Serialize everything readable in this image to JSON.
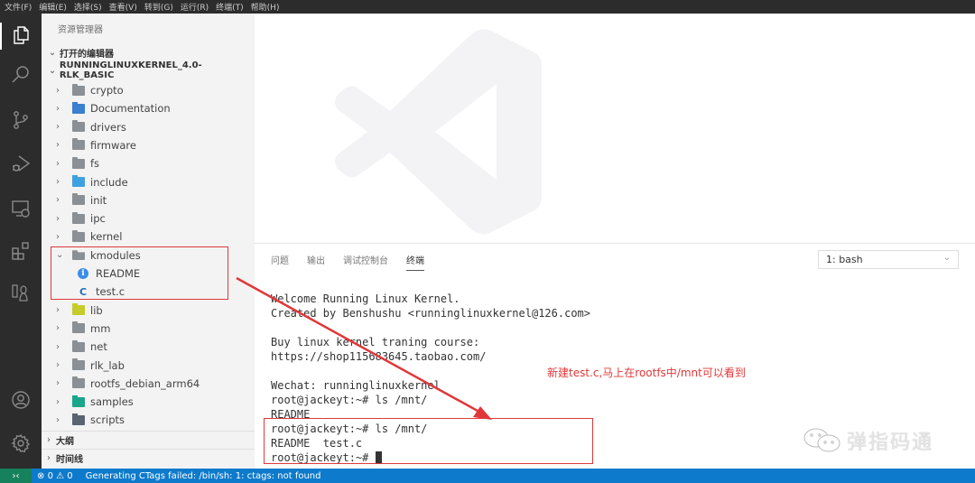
{
  "menubar": {
    "items": [
      "文件(F)",
      "编辑(E)",
      "选择(S)",
      "查看(V)",
      "转到(G)",
      "运行(R)",
      "终端(T)",
      "帮助(H)"
    ]
  },
  "activitybar": {
    "items": [
      "explorer-icon",
      "search-icon",
      "source-control-icon",
      "run-debug-icon",
      "remote-explorer-icon",
      "extensions-icon",
      "linux-icon"
    ],
    "bottom": [
      "account-icon",
      "settings-gear-icon"
    ]
  },
  "sidebar": {
    "title": "资源管理器",
    "open_editors": "打开的编辑器",
    "project": "RUNNINGLINUXKERNEL_4.0-RLK_BASIC",
    "tree": [
      {
        "name": "crypto",
        "type": "folder",
        "icon": "folder"
      },
      {
        "name": "Documentation",
        "type": "folder",
        "icon": "folder-doc"
      },
      {
        "name": "drivers",
        "type": "folder",
        "icon": "folder"
      },
      {
        "name": "firmware",
        "type": "folder",
        "icon": "folder"
      },
      {
        "name": "fs",
        "type": "folder",
        "icon": "folder"
      },
      {
        "name": "include",
        "type": "folder",
        "icon": "folder-inc"
      },
      {
        "name": "init",
        "type": "folder",
        "icon": "folder"
      },
      {
        "name": "ipc",
        "type": "folder",
        "icon": "folder"
      },
      {
        "name": "kernel",
        "type": "folder",
        "icon": "folder"
      },
      {
        "name": "kmodules",
        "type": "folder-open",
        "icon": "folder-open"
      },
      {
        "name": "README",
        "type": "file",
        "icon": "info"
      },
      {
        "name": "test.c",
        "type": "file",
        "icon": "c"
      },
      {
        "name": "lib",
        "type": "folder",
        "icon": "folder-lib"
      },
      {
        "name": "mm",
        "type": "folder",
        "icon": "folder"
      },
      {
        "name": "net",
        "type": "folder",
        "icon": "folder"
      },
      {
        "name": "rlk_lab",
        "type": "folder",
        "icon": "folder"
      },
      {
        "name": "rootfs_debian_arm64",
        "type": "folder",
        "icon": "folder"
      },
      {
        "name": "samples",
        "type": "folder",
        "icon": "folder-smp"
      },
      {
        "name": "scripts",
        "type": "folder",
        "icon": "folder-scr"
      }
    ],
    "outline": "大纲",
    "timeline": "时间线"
  },
  "panel": {
    "tabs": [
      "问题",
      "输出",
      "调试控制台",
      "终端"
    ],
    "active_tab": "终端",
    "terminal_select": "1: bash",
    "terminal_lines": [
      "Welcome Running Linux Kernel.",
      "Created by Benshushu <runninglinuxkernel@126.com>",
      "",
      "Buy linux kernel traning course:",
      "https://shop115683645.taobao.com/",
      "",
      "Wechat: runninglinuxkernel",
      "root@jackeyt:~# ls /mnt/",
      "README",
      "root@jackeyt:~# ls /mnt/",
      "README  test.c",
      "root@jackeyt:~# "
    ]
  },
  "annotation": {
    "text": "新建test.c,马上在rootfs中/mnt可以看到",
    "color": "#e0383a"
  },
  "watermark": "弹指码通",
  "statusbar": {
    "errors": "0",
    "warnings": "0",
    "message": "Generating CTags failed: /bin/sh: 1: ctags: not found"
  }
}
